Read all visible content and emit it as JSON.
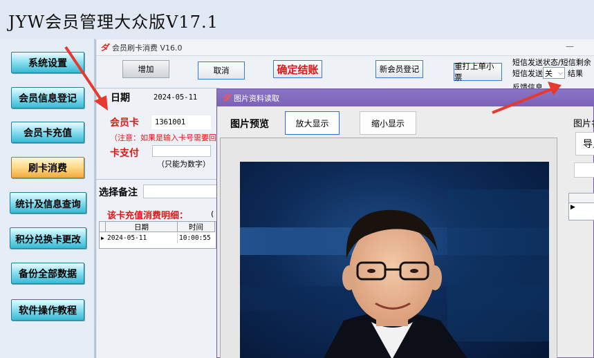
{
  "app": {
    "title": "JYW会员管理大众版V17.1"
  },
  "sidebar": {
    "items": [
      {
        "label": "系统设置"
      },
      {
        "label": "会员信息登记"
      },
      {
        "label": "会员卡充值"
      },
      {
        "label": "刷卡消费"
      },
      {
        "label": "统计及信息查询"
      },
      {
        "label": "积分兑换卡更改"
      },
      {
        "label": "备份全部数据"
      },
      {
        "label": "软件操作教程"
      }
    ],
    "active_index": 3
  },
  "window": {
    "title": "会员刷卡消费 V16.0",
    "min_glyph": "—",
    "toolbar": {
      "add": "增加",
      "cancel": "取消",
      "confirm": "确定结账",
      "new_member": "新会员登记",
      "reprint": "重打上单小票"
    },
    "sms": {
      "line1": "短信发送状态/短信剩余",
      "send_label": "短信发送",
      "send_value": "关",
      "result_label": "结果",
      "feedback_label": "反馈信息"
    },
    "form": {
      "date_label": "日期",
      "date_value": "2024-05-11",
      "card_label": "会员卡",
      "card_value": "1361001",
      "note": "（注意：如果是输入卡号需要回车",
      "card_pay_label": "卡支付",
      "card_pay_value": "",
      "numbers_only": "（只能为数字）",
      "remark_label": "选择备注",
      "remark_value": ""
    },
    "detail": {
      "title": "该卡充值消费明细：",
      "paren": "(",
      "columns": [
        "日期",
        "时间"
      ],
      "rows": [
        {
          "date": "2024-05-11",
          "time": "10:00:55"
        }
      ],
      "row_pointer": "▶"
    }
  },
  "dialog": {
    "title": "图片资料读取",
    "preview_label": "图片预览",
    "zoom_in": "放大显示",
    "zoom_out": "缩小显示",
    "right_label": "图片名",
    "import_label": "导入",
    "row_pointer": "▶"
  },
  "colors": {
    "sidebar_button": "#38b9d4",
    "sidebar_active": "#f1a83c",
    "accent_red": "#e01717",
    "dialog_title": "#7b62b8",
    "arrow": "#e53a2e"
  },
  "icons": {
    "window_logo": "app-logo-icon",
    "dialog_logo": "app-logo-icon",
    "dropdown": "chevron-down-icon"
  }
}
